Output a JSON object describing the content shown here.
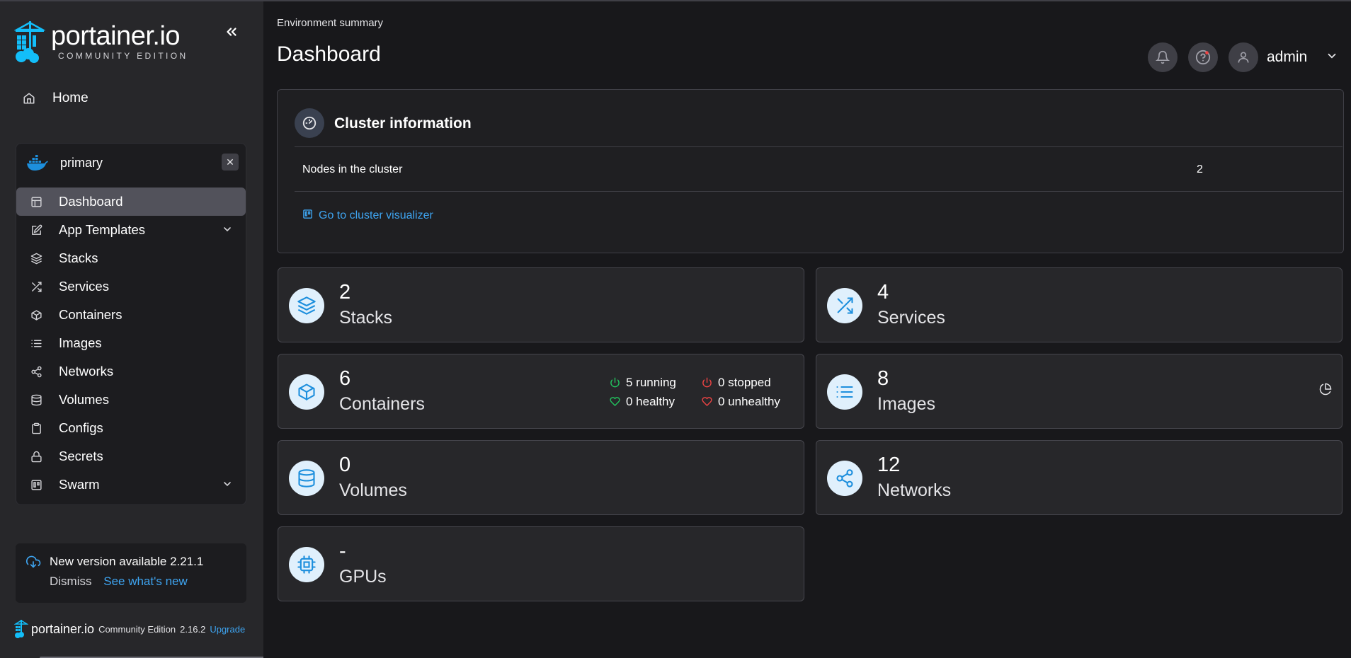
{
  "sidebar": {
    "logo_text": "portainer.io",
    "logo_sub": "COMMUNITY EDITION",
    "home_label": "Home",
    "environment": {
      "name": "primary",
      "close_glyph": "✕",
      "items": [
        {
          "label": "Dashboard",
          "icon": "dashboard-icon",
          "active": true
        },
        {
          "label": "App Templates",
          "icon": "edit-icon",
          "expandable": true
        },
        {
          "label": "Stacks",
          "icon": "layers-icon"
        },
        {
          "label": "Services",
          "icon": "shuffle-icon"
        },
        {
          "label": "Containers",
          "icon": "box-icon"
        },
        {
          "label": "Images",
          "icon": "list-icon"
        },
        {
          "label": "Networks",
          "icon": "share-icon"
        },
        {
          "label": "Volumes",
          "icon": "database-icon"
        },
        {
          "label": "Configs",
          "icon": "clipboard-icon"
        },
        {
          "label": "Secrets",
          "icon": "lock-icon"
        },
        {
          "label": "Swarm",
          "icon": "swarm-icon",
          "expandable": true
        }
      ]
    },
    "update": {
      "title": "New version available 2.21.1",
      "dismiss": "Dismiss",
      "see_new": "See what's new"
    },
    "footer": {
      "logo_text": "portainer.io",
      "edition": "Community Edition",
      "version": "2.16.2",
      "upgrade": "Upgrade"
    }
  },
  "header": {
    "breadcrumb": "Environment summary",
    "title": "Dashboard",
    "user": "admin"
  },
  "cluster": {
    "title": "Cluster information",
    "row_label": "Nodes in the cluster",
    "row_value": "2",
    "link": "Go to cluster visualizer"
  },
  "cards": {
    "stacks": {
      "value": "2",
      "label": "Stacks"
    },
    "services": {
      "value": "4",
      "label": "Services"
    },
    "containers": {
      "value": "6",
      "label": "Containers",
      "running": "5 running",
      "stopped": "0 stopped",
      "healthy": "0 healthy",
      "unhealthy": "0 unhealthy"
    },
    "images": {
      "value": "8",
      "label": "Images"
    },
    "volumes": {
      "value": "0",
      "label": "Volumes"
    },
    "networks": {
      "value": "12",
      "label": "Networks"
    },
    "gpus": {
      "value": "-",
      "label": "GPUs"
    }
  },
  "colors": {
    "accent": "#3ea4f0",
    "icon_bg": "#e0f0fc",
    "icon_fg": "#1d8fdd",
    "running": "#22c55e",
    "stopped": "#ef4444"
  }
}
